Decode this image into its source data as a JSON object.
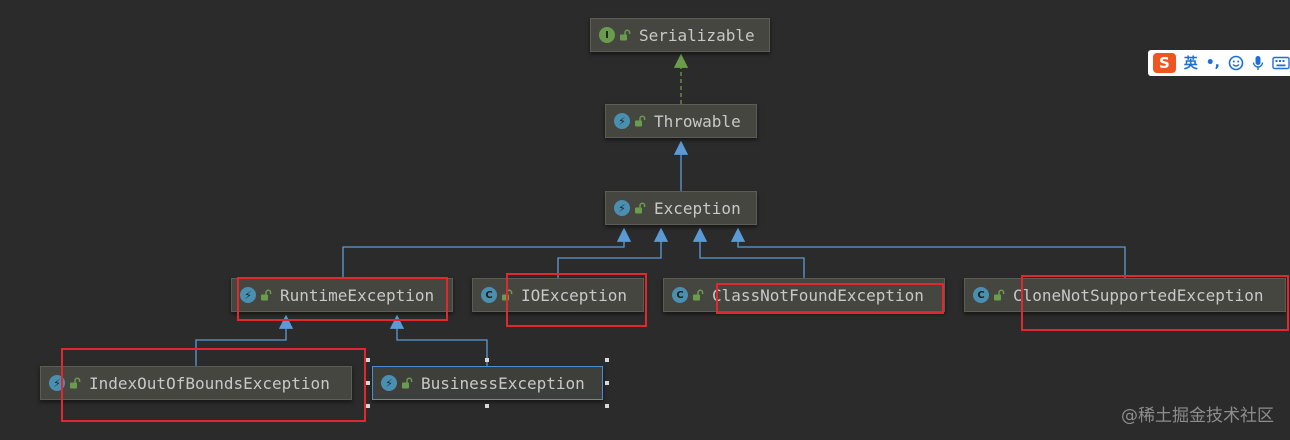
{
  "diagram": {
    "nodes": {
      "serializable": {
        "label": "Serializable",
        "kind": "interface",
        "badge": "I"
      },
      "throwable": {
        "label": "Throwable",
        "kind": "exception",
        "badge": "⚡"
      },
      "exception": {
        "label": "Exception",
        "kind": "exception",
        "badge": "⚡"
      },
      "runtime_exception": {
        "label": "RuntimeException",
        "kind": "exception",
        "badge": "⚡"
      },
      "io_exception": {
        "label": "IOException",
        "kind": "class",
        "badge": "C"
      },
      "class_not_found_exception": {
        "label": "ClassNotFoundException",
        "kind": "class",
        "badge": "C"
      },
      "clone_not_supported_exception": {
        "label": "CloneNotSupportedException",
        "kind": "class",
        "badge": "C"
      },
      "index_out_of_bounds_exception": {
        "label": "IndexOutOfBoundsException",
        "kind": "exception",
        "badge": "⚡"
      },
      "business_exception": {
        "label": "BusinessException",
        "kind": "exception",
        "badge": "⚡",
        "selected": true
      }
    },
    "edges": [
      {
        "from": "throwable",
        "to": "serializable",
        "type": "implements"
      },
      {
        "from": "exception",
        "to": "throwable",
        "type": "extends"
      },
      {
        "from": "runtime_exception",
        "to": "exception",
        "type": "extends"
      },
      {
        "from": "io_exception",
        "to": "exception",
        "type": "extends"
      },
      {
        "from": "class_not_found_exception",
        "to": "exception",
        "type": "extends"
      },
      {
        "from": "clone_not_supported_exception",
        "to": "exception",
        "type": "extends"
      },
      {
        "from": "index_out_of_bounds_exception",
        "to": "runtime_exception",
        "type": "extends"
      },
      {
        "from": "business_exception",
        "to": "runtime_exception",
        "type": "extends"
      }
    ],
    "highlighted": [
      "runtime_exception",
      "io_exception",
      "class_not_found_exception",
      "clone_not_supported_exception",
      "index_out_of_bounds_exception"
    ]
  },
  "colors": {
    "background": "#2b2b2b",
    "node_fill": "#45463f",
    "extends_edge": "#5b9bd5",
    "implements_edge": "#6a9c4e",
    "highlight": "#e0282e",
    "selection": "#4d8fd6"
  },
  "ime_toolbar": {
    "logo": "S",
    "language": "英",
    "punctuation": "•,",
    "icons": [
      "smiley-icon",
      "microphone-icon",
      "keyboard-icon"
    ]
  },
  "watermark": "@稀土掘金技术社区"
}
